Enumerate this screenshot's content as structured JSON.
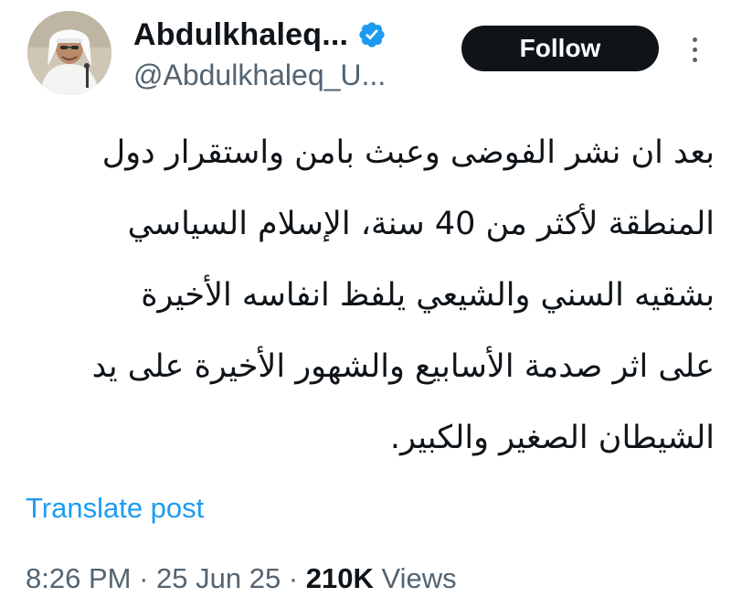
{
  "author": {
    "display_name": "Abdulkhaleq...",
    "handle": "@Abdulkhaleq_U...",
    "verified_icon": "verified-badge-icon",
    "avatar_icon": "profile-photo"
  },
  "actions": {
    "follow_label": "Follow",
    "more_icon": "more-options-icon"
  },
  "tweet": {
    "lines": [
      "بعد ان نشر الفوضى وعبث بامن واستقرار دول",
      "المنطقة لأكثر من 40 سنة، الإسلام السياسي",
      "بشقيه السني والشيعي يلفظ انفاسه الأخيرة",
      "على اثر صدمة الأسابيع والشهور الأخيرة على يد",
      "الشيطان الصغير والكبير."
    ],
    "translate_label": "Translate post"
  },
  "meta": {
    "time": "8:26 PM",
    "separator": " · ",
    "date": "25 Jun 25",
    "views_count": "210K",
    "views_label": " Views"
  },
  "colors": {
    "accent": "#1d9bf0",
    "text": "#0f1419",
    "muted": "#536471",
    "follow_bg": "#0f1419"
  }
}
